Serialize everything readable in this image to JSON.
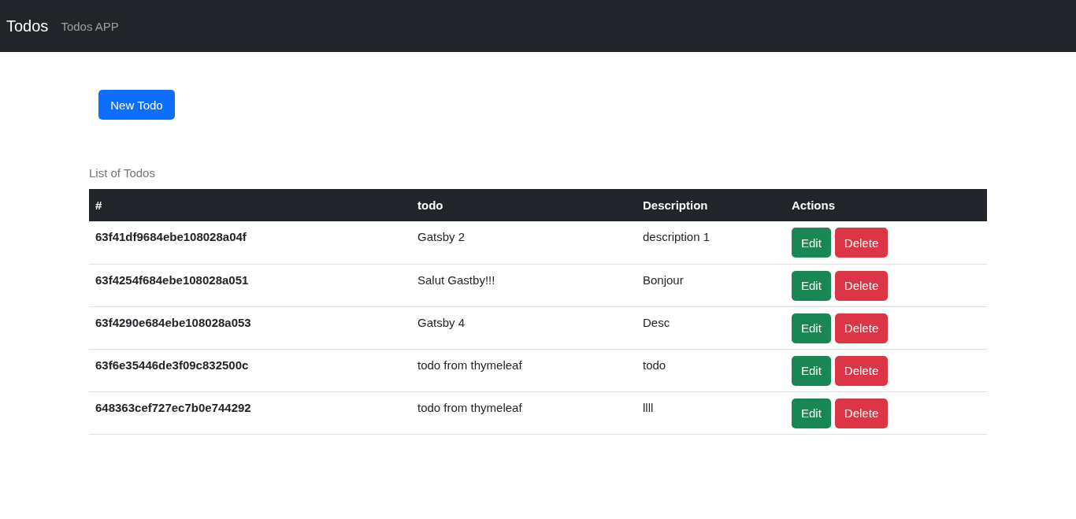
{
  "navbar": {
    "brand": "Todos",
    "link": "Todos APP"
  },
  "new_button": "New Todo",
  "table": {
    "caption": "List of Todos",
    "columns": [
      "#",
      "todo",
      "Description",
      "Actions"
    ],
    "rows": [
      {
        "id": "63f41df9684ebe108028a04f",
        "todo": "Gatsby 2",
        "description": "description 1",
        "actions": [
          "Edit",
          "Delete"
        ]
      },
      {
        "id": "63f4254f684ebe108028a051",
        "todo": "Salut Gastby!!!",
        "description": "Bonjour",
        "actions": [
          "Edit",
          "Delete"
        ]
      },
      {
        "id": "63f4290e684ebe108028a053",
        "todo": "Gatsby 4",
        "description": "Desc",
        "actions": [
          "Edit",
          "Delete"
        ]
      },
      {
        "id": "63f6e35446de3f09c832500c",
        "todo": "todo from thymeleaf",
        "description": "todo",
        "actions": [
          "Edit",
          "Delete"
        ]
      },
      {
        "id": "648363cef727ec7b0e744292",
        "todo": "todo from thymeleaf",
        "description": "llll",
        "actions": [
          "Edit",
          "Delete"
        ]
      }
    ]
  }
}
